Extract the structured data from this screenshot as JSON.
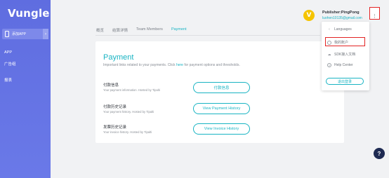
{
  "sidebar": {
    "logo": "Vungle",
    "add_app_label": "添加APP",
    "chevron": "›",
    "items": [
      {
        "label": "APP"
      },
      {
        "label": "广告组"
      },
      {
        "label": "报表"
      }
    ]
  },
  "tabs": [
    {
      "label": "概览",
      "active": false
    },
    {
      "label": "结算详情",
      "active": false
    },
    {
      "label": "Team Members",
      "active": false
    },
    {
      "label": "Payment",
      "active": true
    }
  ],
  "header": {
    "avatar_letter": "V",
    "publisher": "Publisher:PingPong",
    "email": "luohen10135@gmail.com",
    "menu_glyph": "⋮"
  },
  "dropdown": {
    "items": [
      {
        "label": "Languages",
        "icon": "globe-icon"
      },
      {
        "label": "我的账户",
        "icon": "user-icon"
      },
      {
        "label": "SDK接入文档",
        "icon": "cloud-icon"
      },
      {
        "label": "Help Center",
        "icon": "question-icon"
      }
    ],
    "logout_label": "退出登录"
  },
  "payment": {
    "title": "Payment",
    "subtitle_pre": "Important links related to your payments. Click ",
    "subtitle_link": "here",
    "subtitle_post": " for payment options and thresholds.",
    "rows": [
      {
        "title": "付款信息",
        "desc": "Your payment information. Hosted by Tipalti",
        "button": "付款信息"
      },
      {
        "title": "付款历史记录",
        "desc": "Your payment history. Hosted by Tipalti",
        "button": "View Payment History"
      },
      {
        "title": "发票历史记录",
        "desc": "Your invoice history. Hosted by Tipalti",
        "button": "View Invoice History"
      }
    ]
  },
  "help_fab": "?",
  "colors": {
    "accent": "#19b4c3",
    "sidebar": "#6472e4",
    "highlight_box": "#e32323"
  }
}
